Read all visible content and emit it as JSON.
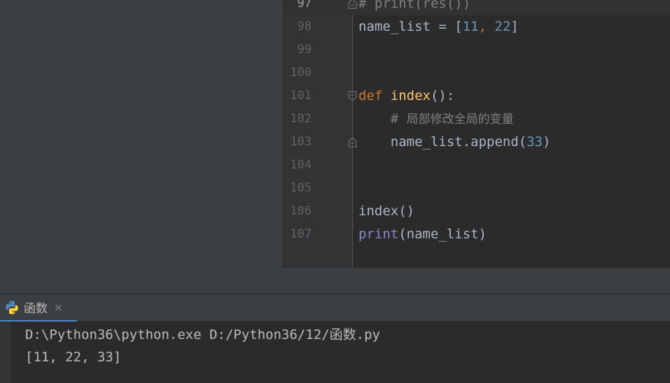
{
  "editor": {
    "lines": [
      {
        "num": "97",
        "segments": [
          {
            "t": "# print(res())",
            "c": "comment"
          }
        ]
      },
      {
        "num": "98",
        "segments": [
          {
            "t": "name_list = [",
            "c": ""
          },
          {
            "t": "11",
            "c": "num"
          },
          {
            "t": ", ",
            "c": "kw"
          },
          {
            "t": "22",
            "c": "num"
          },
          {
            "t": "]",
            "c": ""
          }
        ]
      },
      {
        "num": "99",
        "segments": []
      },
      {
        "num": "100",
        "segments": []
      },
      {
        "num": "101",
        "segments": [
          {
            "t": "def ",
            "c": "kw"
          },
          {
            "t": "index",
            "c": "fn"
          },
          {
            "t": "():",
            "c": ""
          }
        ]
      },
      {
        "num": "102",
        "segments": [
          {
            "t": "    # ",
            "c": "comment"
          },
          {
            "t": "局部修改全局的变量",
            "c": "comment cn-comment"
          }
        ]
      },
      {
        "num": "103",
        "segments": [
          {
            "t": "    name_list.append(",
            "c": ""
          },
          {
            "t": "33",
            "c": "num"
          },
          {
            "t": ")",
            "c": ""
          }
        ]
      },
      {
        "num": "104",
        "segments": []
      },
      {
        "num": "105",
        "segments": []
      },
      {
        "num": "106",
        "segments": [
          {
            "t": "index()",
            "c": ""
          }
        ]
      },
      {
        "num": "107",
        "segments": [
          {
            "t": "print",
            "c": "builtin"
          },
          {
            "t": "(name_list)",
            "c": ""
          }
        ]
      }
    ]
  },
  "run_panel": {
    "tab_label": "函数",
    "close_glyph": "×",
    "console_lines": [
      "D:\\Python36\\python.exe D:/Python36/12/函数.py",
      "[11, 22, 33]"
    ]
  },
  "icons": {
    "tab_icon": "python-icon",
    "fold_icons": [
      "fold-end-icon",
      "fold-start-icon",
      "fold-end-icon"
    ]
  },
  "colors": {
    "keyword": "#cc7832",
    "function": "#ffc66d",
    "number": "#6897bb",
    "builtin": "#8888c6",
    "comment": "#808080",
    "tab_accent": "#4a88c7"
  }
}
